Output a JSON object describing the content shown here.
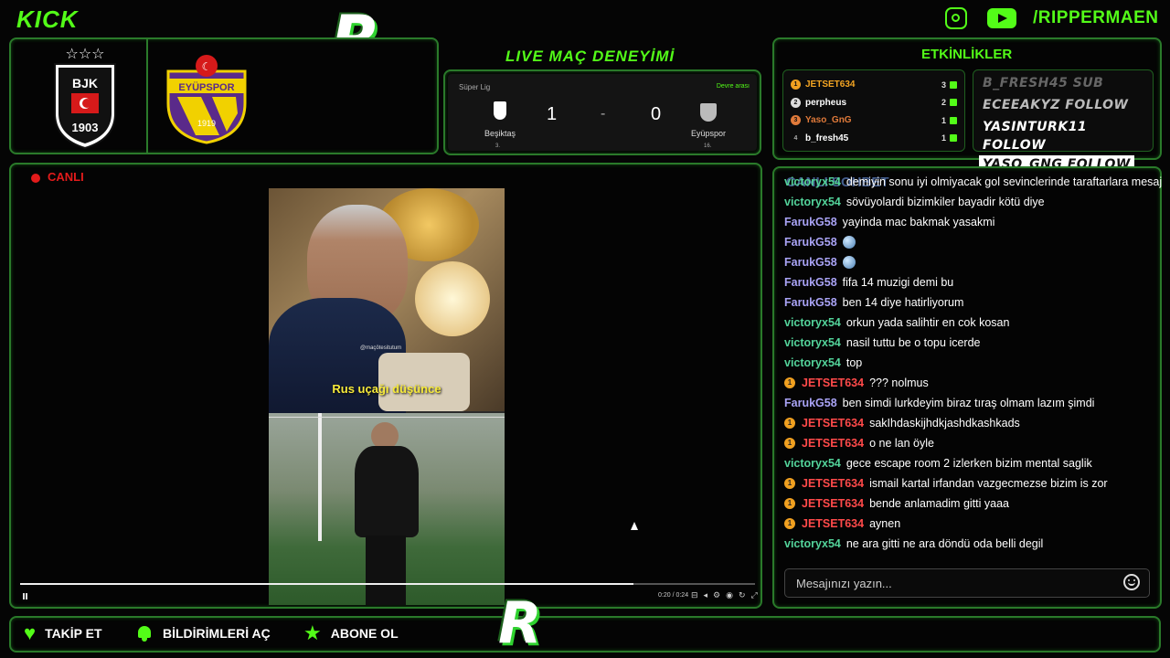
{
  "header": {
    "kick_logo": "KICK",
    "r_logo": "R",
    "handle": "/RIPPERMAEN"
  },
  "teams": {
    "home_crest_text": "BJK",
    "home_year": "1903",
    "away_crest_text": "EYÜPSPOR",
    "away_year": "1919"
  },
  "match": {
    "title": "LIVE MAÇ DENEYİMİ",
    "league": "Süper Lig",
    "status": "Devre arası",
    "home_name": "Beşiktaş",
    "home_rank": "3.",
    "home_score": "1",
    "separator": "-",
    "away_score": "0",
    "away_name": "Eyüpspor",
    "away_rank": "16."
  },
  "live": {
    "badge": "CANLI",
    "chat_title": "CANLI SOHBET"
  },
  "video": {
    "caption": "Rus uçağı düşünce",
    "watermark": "@maçötesitutum",
    "time": "0:20 / 0:24",
    "progress": 0.835
  },
  "events": {
    "title": "ETKİNLİKLER",
    "leaderboard": [
      {
        "rank": "1",
        "name": "JETSET634",
        "count": "3",
        "color": "#f5a623"
      },
      {
        "rank": "2",
        "name": "perpheus",
        "count": "2",
        "color": "#ffffff"
      },
      {
        "rank": "3",
        "name": "Yaso_GnG",
        "count": "1",
        "color": "#e07a3a"
      },
      {
        "rank": "4",
        "name": "b_fresh45",
        "count": "1",
        "color": "#ffffff"
      }
    ],
    "alerts": [
      {
        "text": "B_FRESH45 SUB",
        "style": "dim"
      },
      {
        "text": "ECEEAKYZ FOLLOW",
        "style": "mid"
      },
      {
        "text": "YASINTURK11 FOLLOW",
        "style": "bright"
      },
      {
        "text": "YASO_GNG FOLLOW",
        "style": "highlight"
      }
    ]
  },
  "chat": {
    "messages": [
      {
        "user": "victoryx54",
        "text": "demiyin sonu iyi olmiyacak gol sevinclerinde taraftarlara mesaj",
        "color": "#53d39a",
        "badge": ""
      },
      {
        "user": "victoryx54",
        "text": "sövüyolardi bizimkiler bayadir kötü diye",
        "color": "#53d39a",
        "badge": ""
      },
      {
        "user": "FarukG58",
        "text": "yayinda mac bakmak yasakmi",
        "color": "#a9a3f5",
        "badge": ""
      },
      {
        "user": "FarukG58",
        "text": "",
        "color": "#a9a3f5",
        "badge": "",
        "emoji": true
      },
      {
        "user": "FarukG58",
        "text": "",
        "color": "#a9a3f5",
        "badge": "",
        "emoji": true
      },
      {
        "user": "FarukG58",
        "text": "fifa 14 muzigi demi bu",
        "color": "#a9a3f5",
        "badge": ""
      },
      {
        "user": "FarukG58",
        "text": "ben 14 diye hatirliyorum",
        "color": "#a9a3f5",
        "badge": ""
      },
      {
        "user": "victoryx54",
        "text": "orkun yada salihtir en cok kosan",
        "color": "#53d39a",
        "badge": ""
      },
      {
        "user": "victoryx54",
        "text": "nasil tuttu be o topu icerde",
        "color": "#53d39a",
        "badge": ""
      },
      {
        "user": "victoryx54",
        "text": "top",
        "color": "#53d39a",
        "badge": ""
      },
      {
        "user": "JETSET634",
        "text": "??? nolmus",
        "color": "#ff4a4a",
        "badge": "1"
      },
      {
        "user": "FarukG58",
        "text": "ben simdi lurkdeyim biraz tıraş olmam lazım şimdi",
        "color": "#a9a3f5",
        "badge": ""
      },
      {
        "user": "JETSET634",
        "text": "sakIhdaskijhdkjashdkashkads",
        "color": "#ff4a4a",
        "badge": "1"
      },
      {
        "user": "JETSET634",
        "text": "o ne lan öyle",
        "color": "#ff4a4a",
        "badge": "1"
      },
      {
        "user": "victoryx54",
        "text": "gece escape room 2 izlerken bizim mental saglik",
        "color": "#53d39a",
        "badge": ""
      },
      {
        "user": "JETSET634",
        "text": "ismail kartal irfandan vazgecmezse bizim is zor",
        "color": "#ff4a4a",
        "badge": "1"
      },
      {
        "user": "JETSET634",
        "text": "bende anlamadim gitti yaaa",
        "color": "#ff4a4a",
        "badge": "1"
      },
      {
        "user": "JETSET634",
        "text": "aynen",
        "color": "#ff4a4a",
        "badge": "1"
      },
      {
        "user": "victoryx54",
        "text": "ne ara gitti ne ara döndü oda belli degil",
        "color": "#53d39a",
        "badge": ""
      }
    ],
    "input_placeholder": "Mesajınızı yazın..."
  },
  "footer": {
    "follow": "TAKİP ET",
    "notifications": "BİLDİRİMLERİ AÇ",
    "subscribe": "ABONE OL"
  }
}
